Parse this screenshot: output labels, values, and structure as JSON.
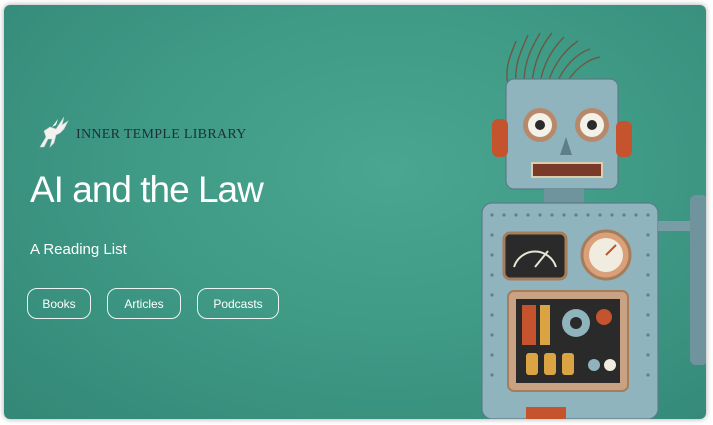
{
  "brand": {
    "name": "INNER TEMPLE LIBRARY",
    "logo_icon": "pegasus-icon"
  },
  "hero": {
    "title": "AI and the Law",
    "subtitle": "A Reading List"
  },
  "nav": {
    "buttons": [
      {
        "label": "Books"
      },
      {
        "label": "Articles"
      },
      {
        "label": "Podcasts"
      }
    ]
  },
  "colors": {
    "background": "#3f9a86",
    "text": "#ffffff",
    "brand_text": "#1d2f3a",
    "robot_body": "#8fb4be"
  },
  "illustration": "toy-robot-image"
}
